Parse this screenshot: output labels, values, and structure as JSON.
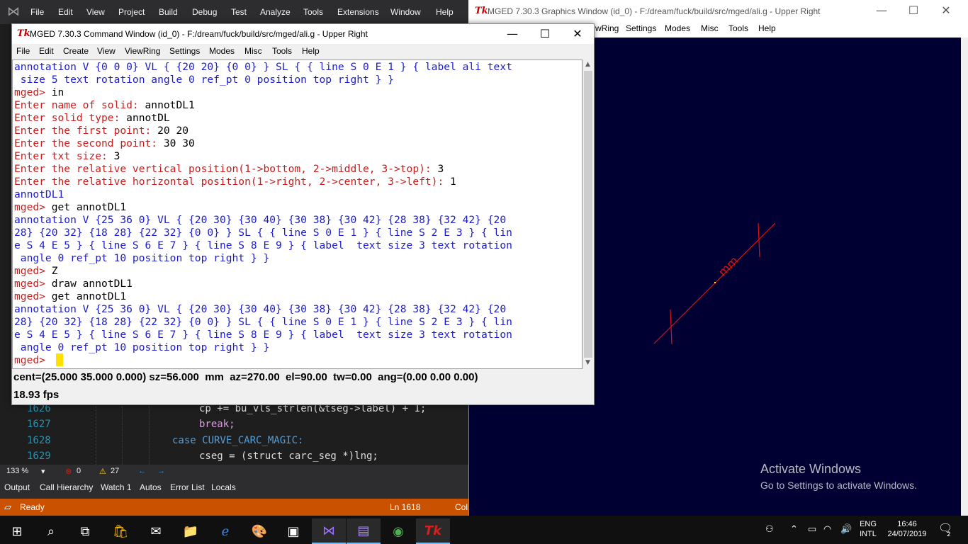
{
  "vs": {
    "menu": [
      "File",
      "Edit",
      "View",
      "Project",
      "Build",
      "Debug",
      "Test",
      "Analyze",
      "Tools",
      "Extensions",
      "Window",
      "Help"
    ],
    "code_lines": [
      {
        "num": "1626",
        "text": "cp += bu_vls_strlen(&tseg->label) + 1;"
      },
      {
        "num": "1627",
        "text": "break;"
      },
      {
        "num": "1628",
        "text": "case CURVE_CARC_MAGIC:"
      },
      {
        "num": "1629",
        "text": "cseg = (struct carc_seg *)lng;"
      }
    ],
    "zoom": "133 %",
    "errors": "0",
    "warnings": "27",
    "tool_tabs": [
      "Output",
      "Call Hierarchy",
      "Watch 1",
      "Autos",
      "Error List",
      "Locals"
    ],
    "status_ready": "Ready",
    "status_ln": "Ln 1618",
    "status_col": "Col"
  },
  "gfx": {
    "title": "MGED 7.30.3 Graphics Window (id_0) - F:/dream/fuck/build/src/mged/ali.g - Upper Right",
    "menu": [
      "wRing",
      "Settings",
      "Modes",
      "Misc",
      "Tools",
      "Help"
    ],
    "annotation_label": "mm",
    "activate_title": "Activate Windows",
    "activate_sub": "Go to Settings to activate Windows."
  },
  "cmd": {
    "icon": "Tk",
    "title": "MGED 7.30.3 Command Window (id_0) - F:/dream/fuck/build/src/mged/ali.g - Upper Right",
    "menu": [
      "File",
      "Edit",
      "Create",
      "View",
      "ViewRing",
      "Settings",
      "Modes",
      "Misc",
      "Tools",
      "Help"
    ],
    "lines": [
      {
        "cls": "blue",
        "text": "annotation V {0 0 0} VL { {20 20} {0 0} } SL { { line S 0 E 1 } { label ali text"
      },
      {
        "cls": "blue",
        "text": " size 5 text rotation angle 0 ref_pt 0 position top right } }"
      },
      {
        "cls": "red",
        "prompt": "mged> ",
        "text": "in"
      },
      {
        "cls": "red",
        "prompt": "Enter name of solid: ",
        "text": "annotDL1"
      },
      {
        "cls": "red",
        "prompt": "Enter solid type: ",
        "text": "annotDL"
      },
      {
        "cls": "red",
        "prompt": "Enter the first point: ",
        "text": "20 20"
      },
      {
        "cls": "red",
        "prompt": "Enter the second point: ",
        "text": "30 30"
      },
      {
        "cls": "red",
        "prompt": "Enter txt size: ",
        "text": "3"
      },
      {
        "cls": "red",
        "prompt": "Enter the relative vertical position(1->bottom, 2->middle, 3->top): ",
        "text": "3"
      },
      {
        "cls": "red",
        "prompt": "Enter the relative horizontal position(1->right, 2->center, 3->left): ",
        "text": "1"
      },
      {
        "cls": "blue",
        "text": "annotDL1"
      },
      {
        "cls": "red",
        "prompt": "mged> ",
        "text": "get annotDL1"
      },
      {
        "cls": "blue",
        "text": "annotation V {25 36 0} VL { {20 30} {30 40} {30 38} {30 42} {28 38} {32 42} {20"
      },
      {
        "cls": "blue",
        "text": "28} {20 32} {18 28} {22 32} {0 0} } SL { { line S 0 E 1 } { line S 2 E 3 } { lin"
      },
      {
        "cls": "blue",
        "text": "e S 4 E 5 } { line S 6 E 7 } { line S 8 E 9 } { label  text size 3 text rotation"
      },
      {
        "cls": "blue",
        "text": " angle 0 ref_pt 10 position top right } }"
      },
      {
        "cls": "red",
        "prompt": "mged> ",
        "text": "Z"
      },
      {
        "cls": "red",
        "prompt": "mged> ",
        "text": "draw annotDL1"
      },
      {
        "cls": "red",
        "prompt": "mged> ",
        "text": "get annotDL1"
      },
      {
        "cls": "blue",
        "text": "annotation V {25 36 0} VL { {20 30} {30 40} {30 38} {30 42} {28 38} {32 42} {20"
      },
      {
        "cls": "blue",
        "text": "28} {20 32} {18 28} {22 32} {0 0} } SL { { line S 0 E 1 } { line S 2 E 3 } { lin"
      },
      {
        "cls": "blue",
        "text": "e S 4 E 5 } { line S 6 E 7 } { line S 8 E 9 } { label  text size 3 text rotation"
      },
      {
        "cls": "blue",
        "text": " angle 0 ref_pt 10 position top right } }"
      },
      {
        "cls": "red",
        "prompt": "mged> ",
        "text": ""
      }
    ],
    "status_line": "cent=(25.000 35.000 0.000) sz=56.000  mm  az=270.00  el=90.00  tw=0.00  ang=(0.00 0.00 0.00)",
    "fps": "18.93 fps"
  },
  "taskbar": {
    "lang_top": "ENG",
    "lang_bottom": "INTL",
    "time": "16:46",
    "date": "24/07/2019",
    "notifications": "2"
  }
}
